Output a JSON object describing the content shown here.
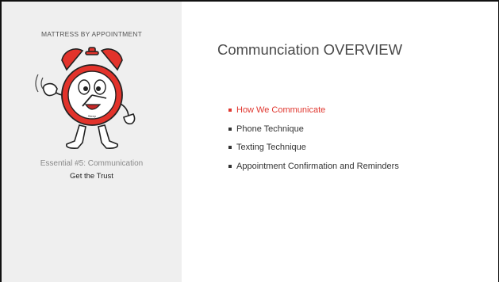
{
  "sidebar": {
    "brand": "MATTRESS BY APPOINTMENT",
    "section_title": "Essential #5: Communication",
    "section_subtitle": "Get the Trust"
  },
  "main": {
    "title": "Communciation OVERVIEW",
    "items": [
      {
        "label": "How We Communicate",
        "active": true
      },
      {
        "label": "Phone Technique",
        "active": false
      },
      {
        "label": "Texting Technique",
        "active": false
      },
      {
        "label": "Appointment Confirmation and Reminders",
        "active": false
      }
    ]
  },
  "mascot": {
    "icon": "alarm-clock-mascot-icon",
    "face_text": "Sleep"
  },
  "colors": {
    "accent": "#e0372f",
    "sidebar_bg": "#efefef",
    "clock_red": "#e2332b"
  }
}
